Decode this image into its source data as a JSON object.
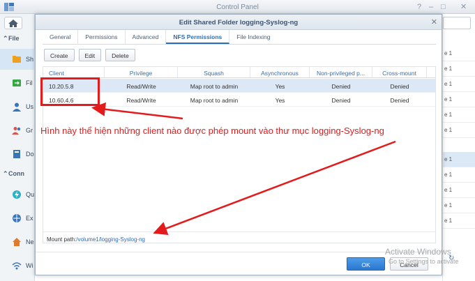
{
  "window": {
    "title": "Control Panel"
  },
  "sidebar": {
    "groups": [
      {
        "label": "File"
      },
      {
        "label": "Conn"
      }
    ],
    "items": [
      {
        "label": "Sh",
        "icon": "shared-folder-icon",
        "selected": true
      },
      {
        "label": "Fil",
        "icon": "file-services-icon"
      },
      {
        "label": "Us",
        "icon": "user-icon"
      },
      {
        "label": "Gr",
        "icon": "group-icon"
      },
      {
        "label": "Do",
        "icon": "domain-icon"
      },
      {
        "label": "Qu",
        "icon": "quickconnect-icon"
      },
      {
        "label": "Ex",
        "icon": "external-access-icon"
      },
      {
        "label": "Ne",
        "icon": "network-icon"
      },
      {
        "label": "Wi",
        "icon": "wireless-icon"
      }
    ]
  },
  "background_list": {
    "cells": [
      "e 1",
      "e 1",
      "e 1",
      "e 1",
      "e 1",
      "e 1",
      "e 1",
      "e 1",
      "e 1",
      "e 1",
      "e 1"
    ]
  },
  "dialog": {
    "title": "Edit Shared Folder logging-Syslog-ng",
    "tabs": [
      "General",
      "Permissions",
      "Advanced",
      "NFS Permissions",
      "File Indexing"
    ],
    "active_tab": "NFS Permissions",
    "toolbar": {
      "create": "Create",
      "edit": "Edit",
      "delete": "Delete"
    },
    "columns": [
      "Client",
      "Privilege",
      "Squash",
      "Asynchronous",
      "Non-privileged p...",
      "Cross-mount"
    ],
    "rows": [
      {
        "client": "10.20.5.8",
        "privilege": "Read/Write",
        "squash": "Map root to admin",
        "async": "Yes",
        "nonpriv": "Denied",
        "cross": "Denied"
      },
      {
        "client": "10.60.4.6",
        "privilege": "Read/Write",
        "squash": "Map root to admin",
        "async": "Yes",
        "nonpriv": "Denied",
        "cross": "Denied"
      }
    ],
    "mount_label": "Mount path:",
    "mount_path": "/volume1/logging-Syslog-ng",
    "ok": "OK",
    "cancel": "Cancel"
  },
  "annotation": "Hình này thể hiện những client nào được phép mount vào thư mục logging-Syslog-ng",
  "watermark": {
    "line1": "Activate Windows",
    "line2": "Go to Settings to activate"
  },
  "colors": {
    "accent": "#2a6fb8",
    "annotation": "#e41b1b"
  }
}
